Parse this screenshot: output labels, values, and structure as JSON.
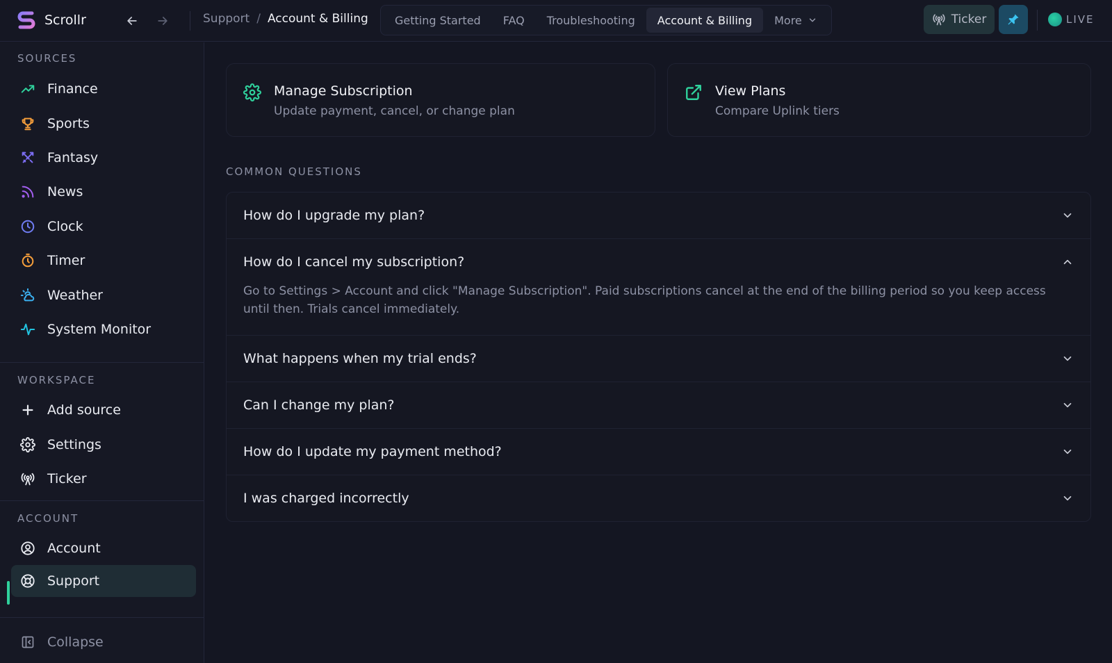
{
  "app": {
    "name": "Scrollr"
  },
  "breadcrumb": {
    "parent": "Support",
    "separator": "/",
    "current": "Account & Billing"
  },
  "tabs": [
    {
      "label": "Getting Started",
      "active": false
    },
    {
      "label": "FAQ",
      "active": false
    },
    {
      "label": "Troubleshooting",
      "active": false
    },
    {
      "label": "Account & Billing",
      "active": true
    },
    {
      "label": "More",
      "active": false
    }
  ],
  "header": {
    "ticker_label": "Ticker",
    "live_label": "LIVE"
  },
  "sidebar": {
    "sources_title": "SOURCES",
    "sources": [
      {
        "label": "Finance",
        "icon": "trending-up-icon"
      },
      {
        "label": "Sports",
        "icon": "trophy-icon"
      },
      {
        "label": "Fantasy",
        "icon": "swords-icon"
      },
      {
        "label": "News",
        "icon": "rss-icon"
      },
      {
        "label": "Clock",
        "icon": "clock-icon"
      },
      {
        "label": "Timer",
        "icon": "timer-icon"
      },
      {
        "label": "Weather",
        "icon": "weather-icon"
      },
      {
        "label": "System Monitor",
        "icon": "activity-icon"
      }
    ],
    "workspace_title": "WORKSPACE",
    "workspace": [
      {
        "label": "Add source",
        "icon": "plus-icon"
      },
      {
        "label": "Settings",
        "icon": "gear-icon"
      },
      {
        "label": "Ticker",
        "icon": "broadcast-icon"
      }
    ],
    "account_title": "ACCOUNT",
    "account": [
      {
        "label": "Account",
        "icon": "user-circle-icon"
      },
      {
        "label": "Support",
        "icon": "lifebuoy-icon",
        "active": true
      }
    ],
    "collapse_label": "Collapse"
  },
  "cards": [
    {
      "title": "Manage Subscription",
      "subtitle": "Update payment, cancel, or change plan",
      "icon": "gear-icon"
    },
    {
      "title": "View Plans",
      "subtitle": "Compare Uplink tiers",
      "icon": "external-link-icon"
    }
  ],
  "faq": {
    "title": "COMMON QUESTIONS",
    "items": [
      {
        "question": "How do I upgrade my plan?",
        "expanded": false
      },
      {
        "question": "How do I cancel my subscription?",
        "expanded": true,
        "answer": "Go to Settings > Account and click \"Manage Subscription\". Paid subscriptions cancel at the end of the billing period so you keep access until then. Trials cancel immediately."
      },
      {
        "question": "What happens when my trial ends?",
        "expanded": false
      },
      {
        "question": "Can I change my plan?",
        "expanded": false
      },
      {
        "question": "How do I update my payment method?",
        "expanded": false
      },
      {
        "question": "I was charged incorrectly",
        "expanded": false
      }
    ]
  },
  "colors": {
    "background": "#141622",
    "accent_green": "#2fd19c",
    "pin_button": "#1c4a63"
  }
}
